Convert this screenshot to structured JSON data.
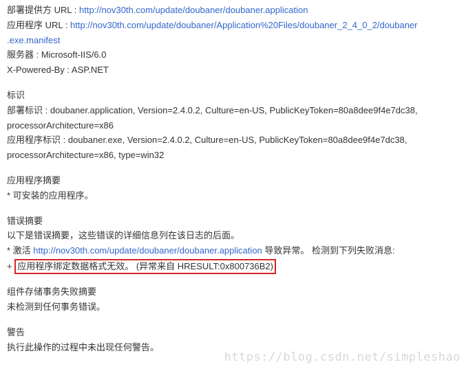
{
  "deploy_provider_label": "部署提供方 URL : ",
  "deploy_provider_url": "http://nov30th.com/update/doubaner/doubaner.application",
  "app_url_label": "应用程序 URL : ",
  "app_url_1": "http://nov30th.com/update/doubaner/Application%20Files/doubaner_2_4_0_2/doubaner",
  "app_url_2": ".exe.manifest",
  "server_line": "服务器 : Microsoft-IIS/6.0",
  "xpowered_line": "X-Powered-By : ASP.NET",
  "identity_heading": "标识",
  "deploy_identity_1": "部署标识 : doubaner.application, Version=2.4.0.2, Culture=en-US, PublicKeyToken=80a8dee9f4e7dc38,",
  "deploy_identity_2": "processorArchitecture=x86",
  "app_identity_1": "应用程序标识 : doubaner.exe, Version=2.4.0.2, Culture=en-US, PublicKeyToken=80a8dee9f4e7dc38,",
  "app_identity_2": "processorArchitecture=x86, type=win32",
  "app_summary_heading": "应用程序摘要",
  "app_summary_item": "* 可安装的应用程序。",
  "error_summary_heading": "错误摘要",
  "error_summary_intro": "以下是错误摘要，这些错误的详细信息列在该日志的后面。",
  "activate_prefix": "* 激活 ",
  "activate_url": "http://nov30th.com/update/doubaner/doubaner.application",
  "activate_suffix": " 导致异常。 检测到下列失败消息:",
  "error_plus": "+ ",
  "error_boxed": "应用程序绑定数据格式无效。 (异常来自 HRESULT:0x800736B2)",
  "store_heading": "组件存储事务失败摘要",
  "store_msg": "未检测到任何事务错误。",
  "warn_heading": "警告",
  "warn_msg": "执行此操作的过程中未出现任何警告。",
  "watermark": "https://blog.csdn.net/simpleshao"
}
